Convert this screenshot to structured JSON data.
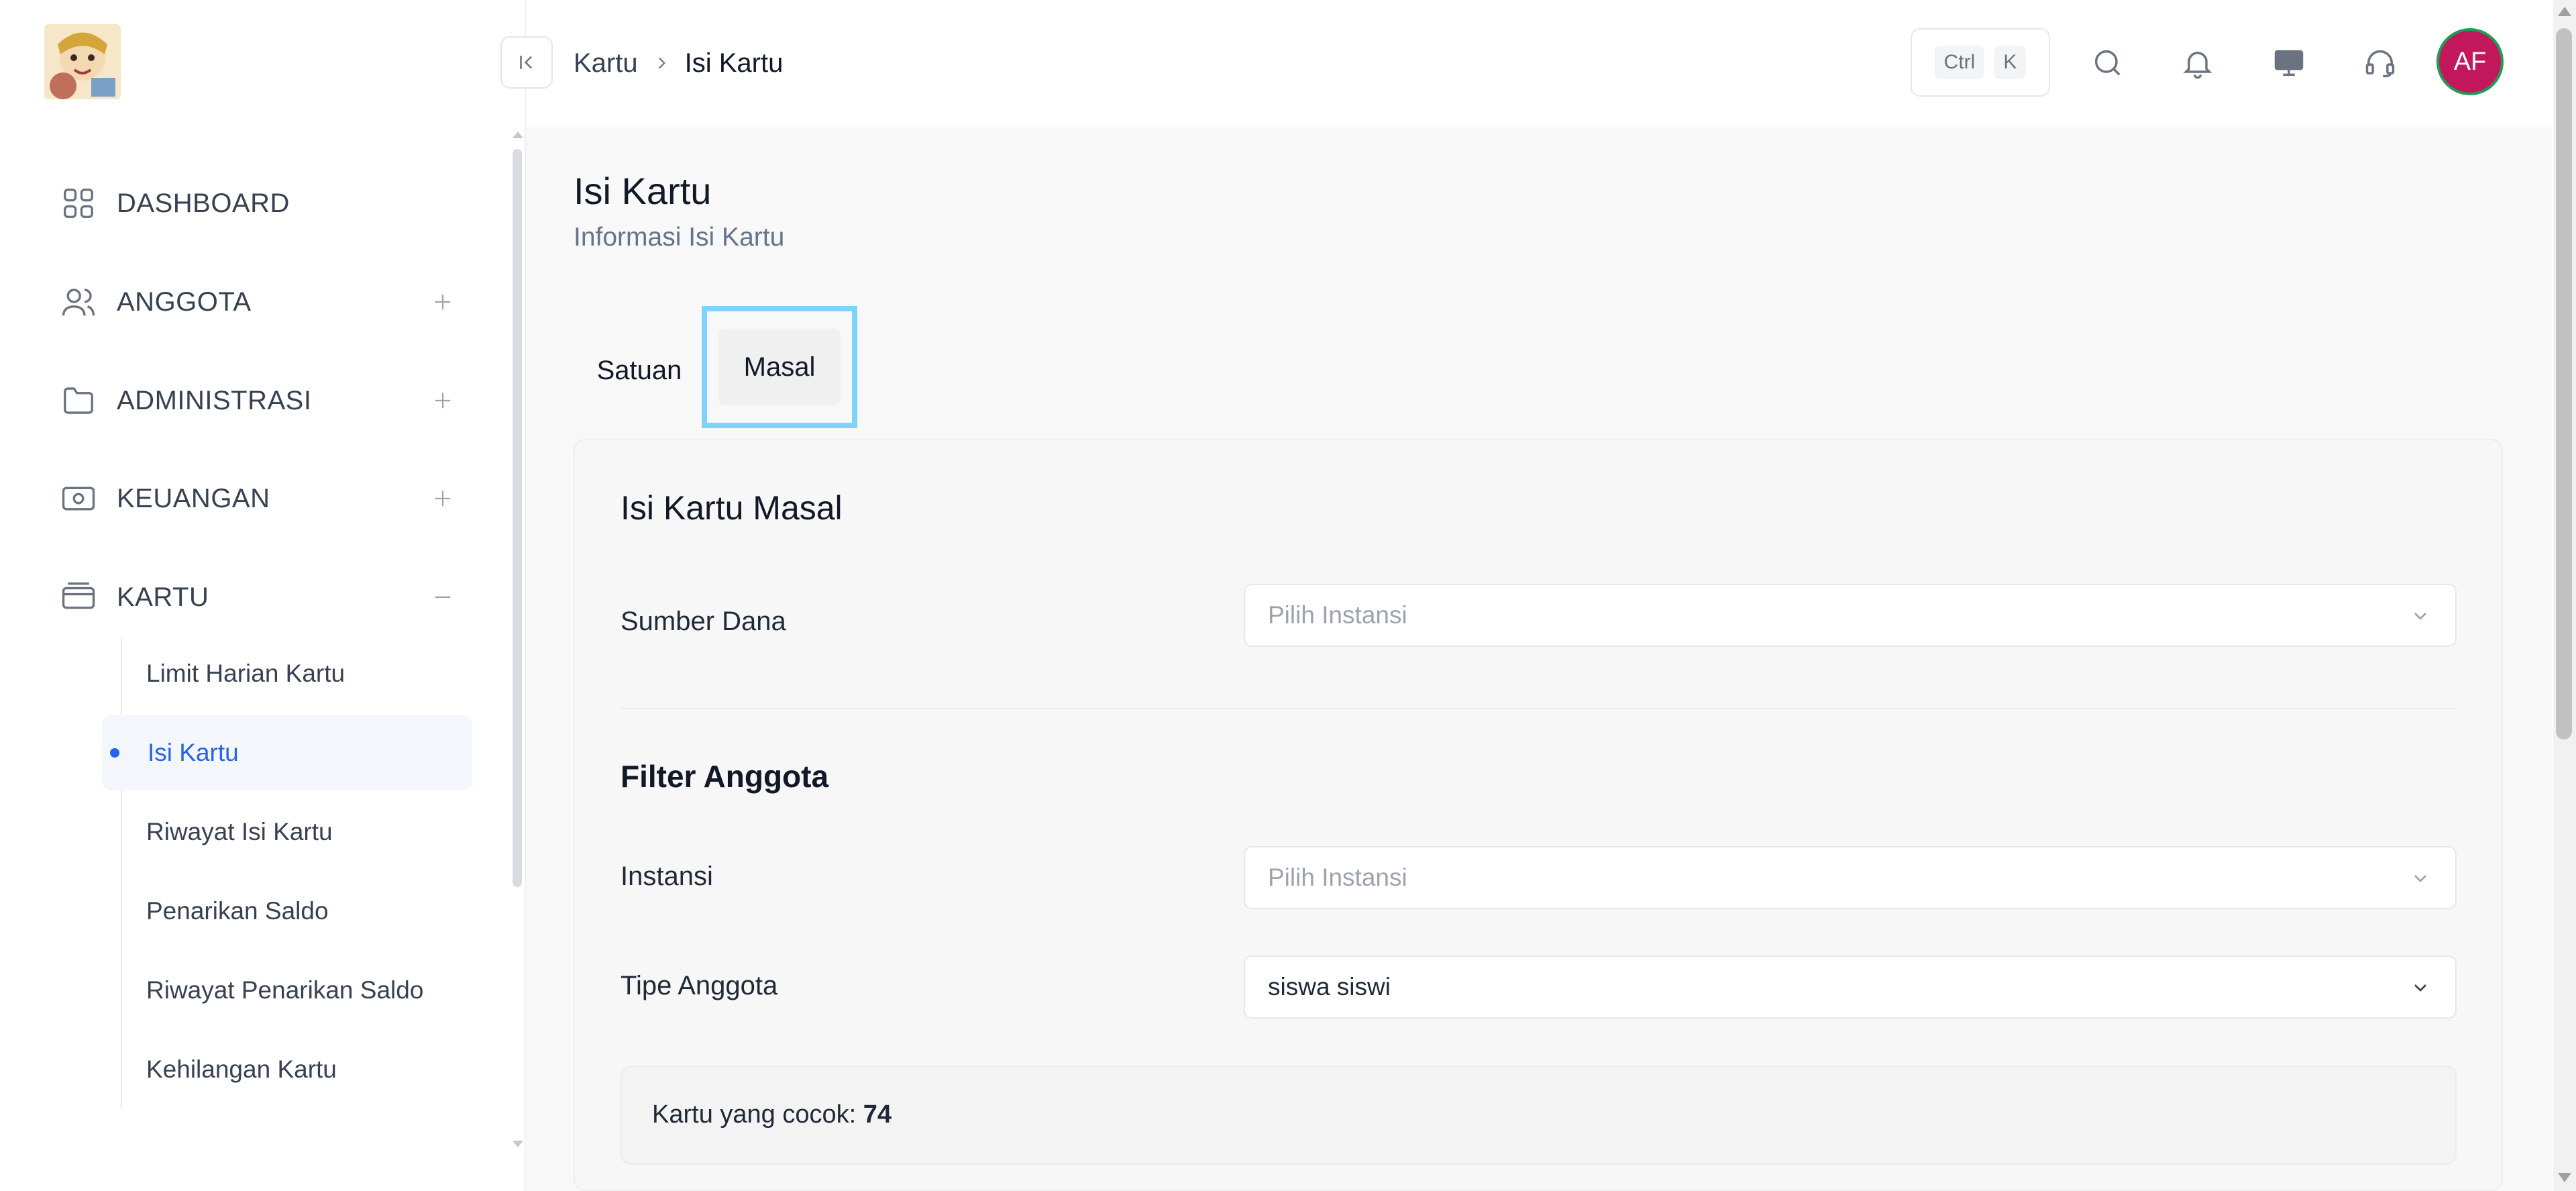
{
  "sidebar": {
    "items": [
      {
        "label": "DASHBOARD",
        "icon": "grid-icon"
      },
      {
        "label": "ANGGOTA",
        "icon": "users-icon"
      },
      {
        "label": "ADMINISTRASI",
        "icon": "folder-icon"
      },
      {
        "label": "KEUANGAN",
        "icon": "cash-icon"
      },
      {
        "label": "KARTU",
        "icon": "card-icon"
      }
    ],
    "kartu_sub": [
      "Limit Harian Kartu",
      "Isi Kartu",
      "Riwayat Isi Kartu",
      "Penarikan Saldo",
      "Riwayat Penarikan Saldo",
      "Kehilangan Kartu"
    ],
    "active_sub": "Isi Kartu"
  },
  "header": {
    "breadcrumb": [
      "Kartu",
      "Isi Kartu"
    ],
    "shortcut_keys": [
      "Ctrl",
      "K"
    ],
    "icons": [
      "search-icon",
      "bell-icon",
      "monitor-icon",
      "headset-icon"
    ],
    "avatar_initials": "AF"
  },
  "page": {
    "title": "Isi Kartu",
    "subtitle": "Informasi Isi Kartu",
    "tabs": [
      "Satuan",
      "Masal"
    ],
    "active_tab": "Masal"
  },
  "form": {
    "title": "Isi Kartu Masal",
    "sumber_dana": {
      "label": "Sumber Dana",
      "placeholder": "Pilih Instansi"
    },
    "filter_title": "Filter Anggota",
    "instansi": {
      "label": "Instansi",
      "placeholder": "Pilih Instansi"
    },
    "tipe_anggota": {
      "label": "Tipe Anggota",
      "value": "siswa siswi"
    },
    "match_label": "Kartu yang cocok:",
    "match_count": "74"
  },
  "colors": {
    "accent": "#2563eb",
    "avatar_bg": "#c2185b",
    "avatar_ring": "#1f9d55",
    "tab_highlight": "#7dd3fc"
  }
}
